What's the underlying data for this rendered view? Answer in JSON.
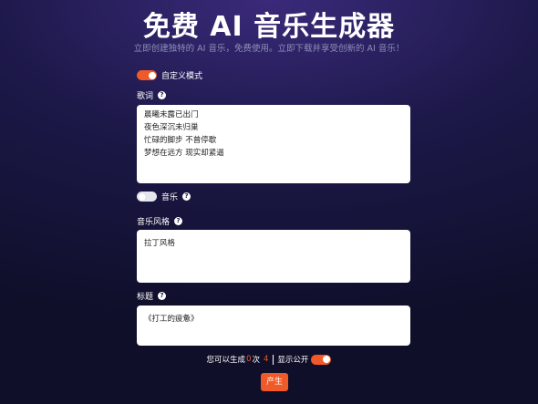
{
  "header": {
    "title": "免费 AI 音乐生成器",
    "subtitle": "立即创建独特的 AI 音乐，免费使用。立即下载并享受创新的 AI 音乐！"
  },
  "custom_mode": {
    "label": "自定义模式",
    "enabled": true
  },
  "lyrics": {
    "label": "歌词",
    "lines": [
      "",
      "",
      "晨曦未露已出门",
      "夜色深沉未归巢",
      "忙碌的脚步 不曾停歇",
      "梦想在远方 现实却紧逼"
    ]
  },
  "music": {
    "label": "音乐",
    "enabled": false
  },
  "style": {
    "label": "音乐风格",
    "value": "拉丁风格"
  },
  "song_title": {
    "label": "标题",
    "value": "《打工的疲惫》"
  },
  "counter": {
    "prefix": "您可以生成",
    "used": "0",
    "unit": "次",
    "remaining": "4",
    "public_label": "显示公开",
    "public_enabled": true
  },
  "generate_button": {
    "label": "产生"
  },
  "colors": {
    "accent": "#f05a28",
    "background": "#1c1848"
  }
}
